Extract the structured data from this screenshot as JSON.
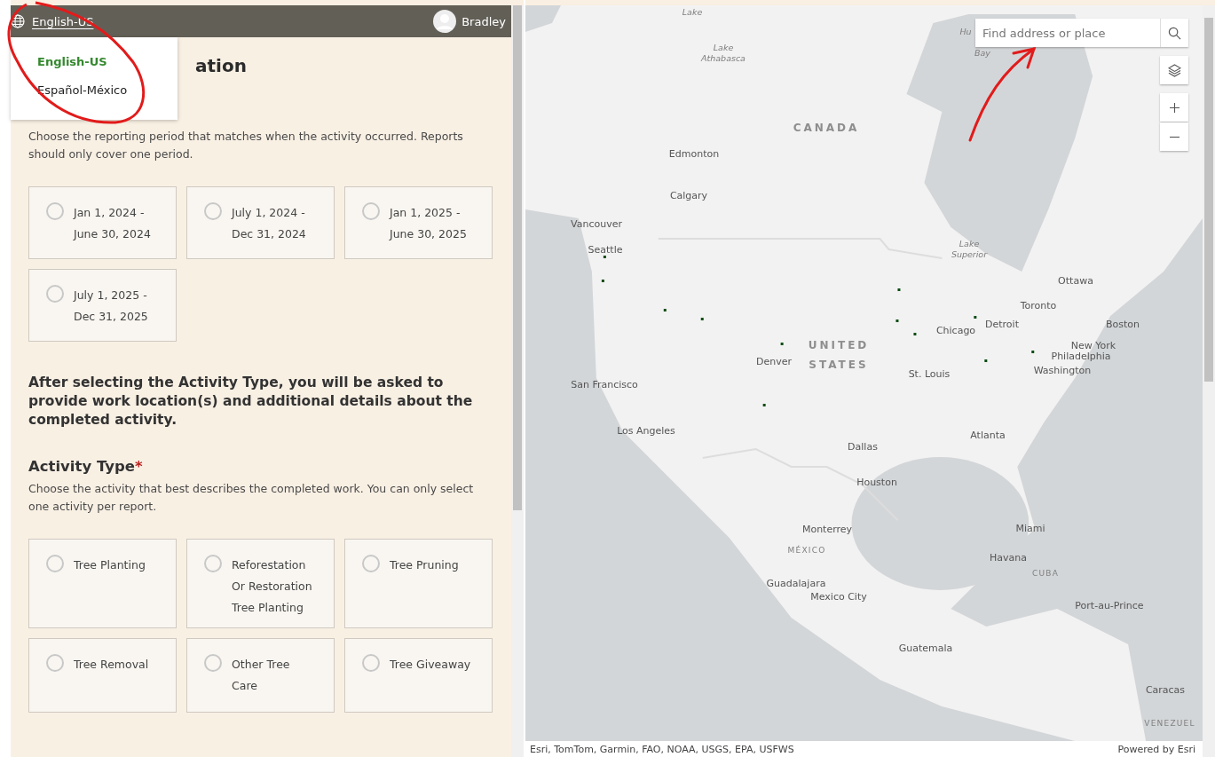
{
  "header": {
    "language": "English-US",
    "user": "Bradley"
  },
  "language_menu": {
    "items": [
      {
        "label": "English-US",
        "selected": true
      },
      {
        "label": "Español-México",
        "selected": false
      }
    ]
  },
  "form": {
    "title_visible": "ation",
    "period_description": "Choose the reporting period that matches when the activity occurred. Reports should only cover one period.",
    "periods": [
      {
        "line1": "Jan 1, 2024 -",
        "line2": "June 30, 2024",
        "selected": false
      },
      {
        "line1": "July 1, 2024 -",
        "line2": "Dec 31, 2024",
        "selected": false
      },
      {
        "line1": "Jan 1, 2025 -",
        "line2": "June 30, 2025",
        "selected": false
      },
      {
        "line1": "July 1, 2025 -",
        "line2": "Dec 31, 2025",
        "selected": false
      }
    ],
    "notice": "After selecting the Activity Type, you will be asked to provide work location(s) and additional details about the completed activity.",
    "activity_label": "Activity Type",
    "required_mark": "*",
    "activity_description": "Choose the activity that best describes the completed work. You can only select one activity per report.",
    "activities": [
      {
        "label": "Tree Planting",
        "selected": false
      },
      {
        "label": "Reforestation Or Restoration Tree Planting",
        "selected": false
      },
      {
        "label": "Tree Pruning",
        "selected": false
      },
      {
        "label": "Tree Removal",
        "selected": false
      },
      {
        "label": "Other Tree Care",
        "selected": false
      },
      {
        "label": "Tree Giveaway",
        "selected": false
      }
    ]
  },
  "map": {
    "search": {
      "placeholder": "Find address or place"
    },
    "labels": [
      {
        "text": "Lake",
        "kind": "water"
      },
      {
        "text": "Lake Athabasca",
        "kind": "water"
      },
      {
        "text": "Hu",
        "kind": "water"
      },
      {
        "text": "Bay",
        "kind": "water"
      },
      {
        "text": "CANADA",
        "kind": "country"
      },
      {
        "text": "Edmonton",
        "kind": "city"
      },
      {
        "text": "Calgary",
        "kind": "city"
      },
      {
        "text": "Vancouver",
        "kind": "city"
      },
      {
        "text": "Seattle",
        "kind": "city"
      },
      {
        "text": "Lake Superior",
        "kind": "water"
      },
      {
        "text": "Ottawa",
        "kind": "city"
      },
      {
        "text": "Toronto",
        "kind": "city"
      },
      {
        "text": "Boston",
        "kind": "city"
      },
      {
        "text": "Detroit",
        "kind": "city"
      },
      {
        "text": "Chicago",
        "kind": "city"
      },
      {
        "text": "New York",
        "kind": "city"
      },
      {
        "text": "Philadelphia",
        "kind": "city"
      },
      {
        "text": "Washington",
        "kind": "city"
      },
      {
        "text": "Denver",
        "kind": "city"
      },
      {
        "text": "UNITED STATES",
        "kind": "country"
      },
      {
        "text": "St. Louis",
        "kind": "city"
      },
      {
        "text": "San Francisco",
        "kind": "city"
      },
      {
        "text": "Los Angeles",
        "kind": "city"
      },
      {
        "text": "Dallas",
        "kind": "city"
      },
      {
        "text": "Atlanta",
        "kind": "city"
      },
      {
        "text": "Houston",
        "kind": "city"
      },
      {
        "text": "Miami",
        "kind": "city"
      },
      {
        "text": "Monterrey",
        "kind": "city"
      },
      {
        "text": "MÉXICO",
        "kind": "region"
      },
      {
        "text": "Havana",
        "kind": "city"
      },
      {
        "text": "CUBA",
        "kind": "region"
      },
      {
        "text": "Guadalajara",
        "kind": "city"
      },
      {
        "text": "Mexico City",
        "kind": "city"
      },
      {
        "text": "Port-au-Prince",
        "kind": "city"
      },
      {
        "text": "Guatemala",
        "kind": "city"
      },
      {
        "text": "Caracas",
        "kind": "city"
      },
      {
        "text": "VENEZUEL",
        "kind": "region"
      }
    ],
    "attribution": "Esri, TomTom, Garmin, FAO, NOAA, USGS, EPA, USFWS",
    "powered_by": "Powered by Esri"
  }
}
